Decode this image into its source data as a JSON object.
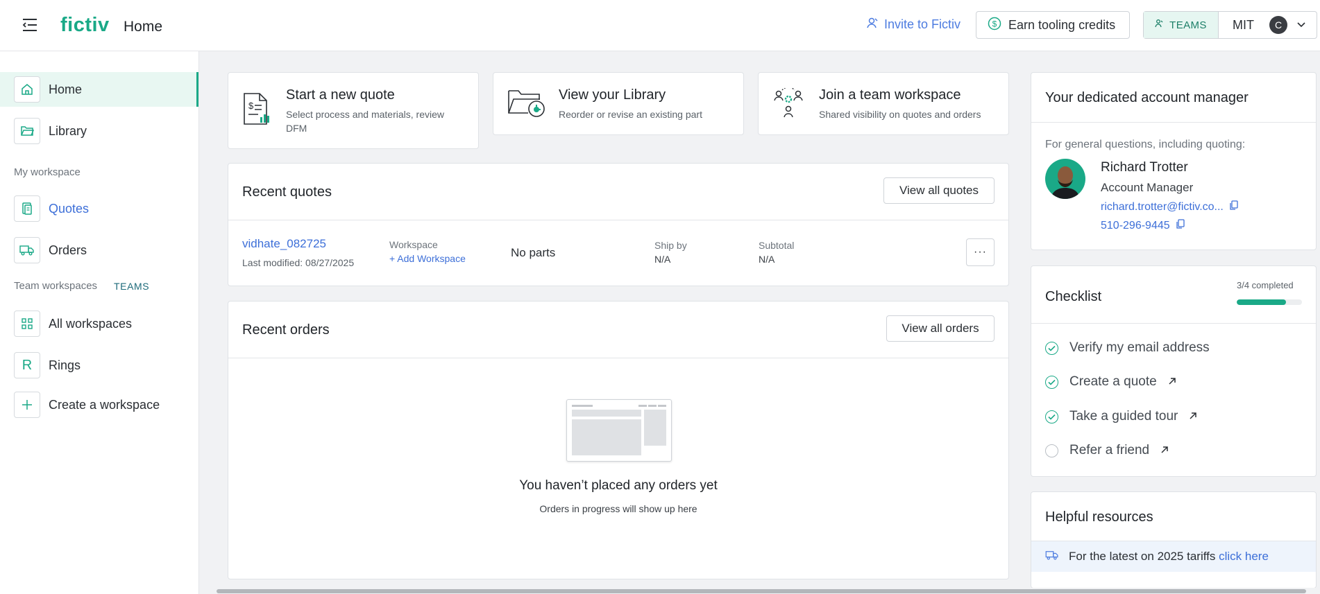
{
  "header": {
    "logo": "fictiv",
    "page_title": "Home",
    "invite_label": "Invite to Fictiv",
    "earn_label": "Earn tooling credits",
    "teams_label": "TEAMS",
    "team_name": "MIT",
    "avatar_initial": "C"
  },
  "sidebar": {
    "items_top": [
      {
        "label": "Home",
        "icon": "home-icon"
      },
      {
        "label": "Library",
        "icon": "folder-icon"
      }
    ],
    "my_workspace_label": "My workspace",
    "workspace_items": [
      {
        "label": "Quotes",
        "icon": "quotes-icon"
      },
      {
        "label": "Orders",
        "icon": "truck-icon"
      }
    ],
    "team_workspaces_label": "Team workspaces",
    "teams_tag": "TEAMS",
    "team_items": [
      {
        "label": "All workspaces",
        "icon": "grid-icon"
      },
      {
        "label": "Rings",
        "icon": "R"
      },
      {
        "label": "Create a workspace",
        "icon": "plus-icon"
      }
    ]
  },
  "actions": [
    {
      "title": "Start a new quote",
      "subtitle": "Select process and materials, review DFM"
    },
    {
      "title": "View your Library",
      "subtitle": "Reorder or revise an existing part"
    },
    {
      "title": "Join a team workspace",
      "subtitle": "Shared visibility on quotes and orders"
    }
  ],
  "recent_quotes": {
    "title": "Recent quotes",
    "view_all": "View all quotes",
    "quote": {
      "name": "vidhate_082725",
      "modified": "Last modified: 08/27/2025",
      "workspace_label": "Workspace",
      "add_workspace": "+ Add Workspace",
      "parts": "No parts",
      "ship_label": "Ship by",
      "ship_value": "N/A",
      "subtotal_label": "Subtotal",
      "subtotal_value": "N/A",
      "more": "···"
    }
  },
  "recent_orders": {
    "title": "Recent orders",
    "view_all": "View all orders",
    "empty_title": "You haven’t placed any orders yet",
    "empty_sub": "Orders in progress will show up here"
  },
  "account_manager": {
    "title": "Your dedicated account manager",
    "intro": "For general questions, including quoting:",
    "name": "Richard Trotter",
    "role": "Account Manager",
    "email": "richard.trotter@fictiv.co...",
    "phone": "510-296-9445"
  },
  "checklist": {
    "title": "Checklist",
    "progress_text": "3/4 completed",
    "progress_fraction": 0.75,
    "items": [
      {
        "label": "Verify my email address",
        "done": true,
        "external": false
      },
      {
        "label": "Create a quote",
        "done": true,
        "external": true
      },
      {
        "label": "Take a guided tour",
        "done": true,
        "external": true
      },
      {
        "label": "Refer a friend",
        "done": false,
        "external": true
      }
    ]
  },
  "resources": {
    "title": "Helpful resources",
    "tariff_text": "For the latest on 2025 tariffs",
    "tariff_link": "click here"
  },
  "colors": {
    "brand": "#1aa987",
    "link": "#3d6fd8",
    "background": "#f1f2f4"
  }
}
